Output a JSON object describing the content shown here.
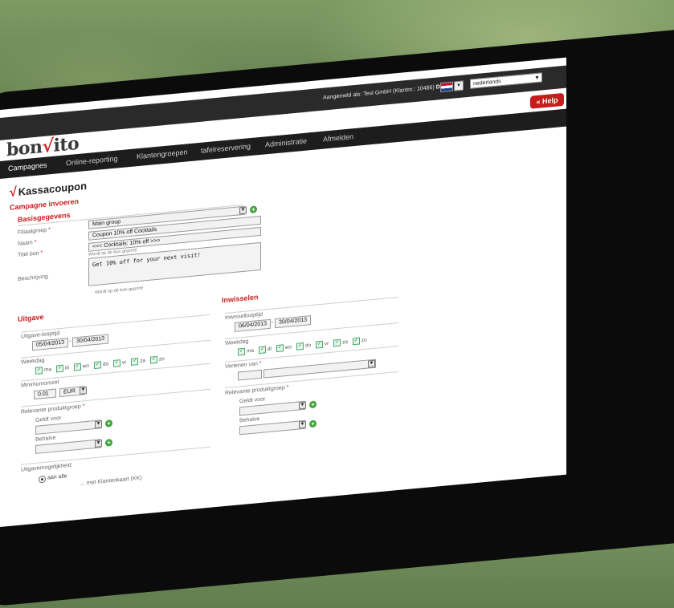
{
  "topbar": {
    "login_prefix": "Aangemeld als: Test GmbH (Klantnr.: 10486) ",
    "login_bold": "DEMO",
    "language": "nederlands"
  },
  "brand": {
    "logo_pre": "bon",
    "logo_post": "ito",
    "logo_mark": "√"
  },
  "help_label": "« Help",
  "nav": [
    "Campagnes",
    "Online-reporting",
    "Klantengroepen",
    "tafelreservering",
    "Administratie",
    "Afmelden"
  ],
  "page": {
    "title": "Kassacoupon",
    "subtitle": "Campagne invoeren"
  },
  "basis": {
    "title": "Basisgegevens",
    "filiaalgroep_label": "Filiaalgroep",
    "filiaalgroep_value": "Main group",
    "naam_label": "Naam",
    "naam_value": "Coupon 10% off Cocktails",
    "titelbon_label": "Titel bon",
    "titelbon_value": "<<< Cocktails: 10% off >>>",
    "titelbon_hint": "Wordt op de bon geprint!",
    "beschrijving_label": "Beschrijving",
    "beschrijving_value": "Get 10% off for your next visit!",
    "beschrijving_hint": "Wordt op de bon geprint!"
  },
  "uitgave": {
    "title": "Uitgave",
    "looptijd_label": "Uitgave-looptijd",
    "date_from": "05/04/2013",
    "date_to": "30/04/2013",
    "weekdag_label": "Weekdag",
    "days": [
      "ma",
      "di",
      "wo",
      "do",
      "vr",
      "za",
      "zo"
    ],
    "min_label": "Minimumomzet",
    "min_value": "0.01",
    "currency": "EUR",
    "relevant_label": "Relevante produktgroep",
    "geldt_label": "Geldt voor",
    "behalve_label": "Behalve",
    "mogelijkheid_label": "Uitgavemogelijkheid",
    "radio_all": "aan alle",
    "radio_card": "... met Klantenkaart (KK)"
  },
  "inwisselen": {
    "title": "Inwisselen",
    "looptijd_label": "Inwissellooptijd",
    "date_from": "06/04/2013",
    "date_to": "30/04/2013",
    "weekdag_label": "Weekdag",
    "days": [
      "ma",
      "di",
      "wo",
      "do",
      "vr",
      "za",
      "zo"
    ],
    "verlenen_label": "Verlenen van",
    "relevant_label": "Relevante produktgroep",
    "geldt_label": "Geldt voor",
    "behalve_label": "Behalve"
  }
}
